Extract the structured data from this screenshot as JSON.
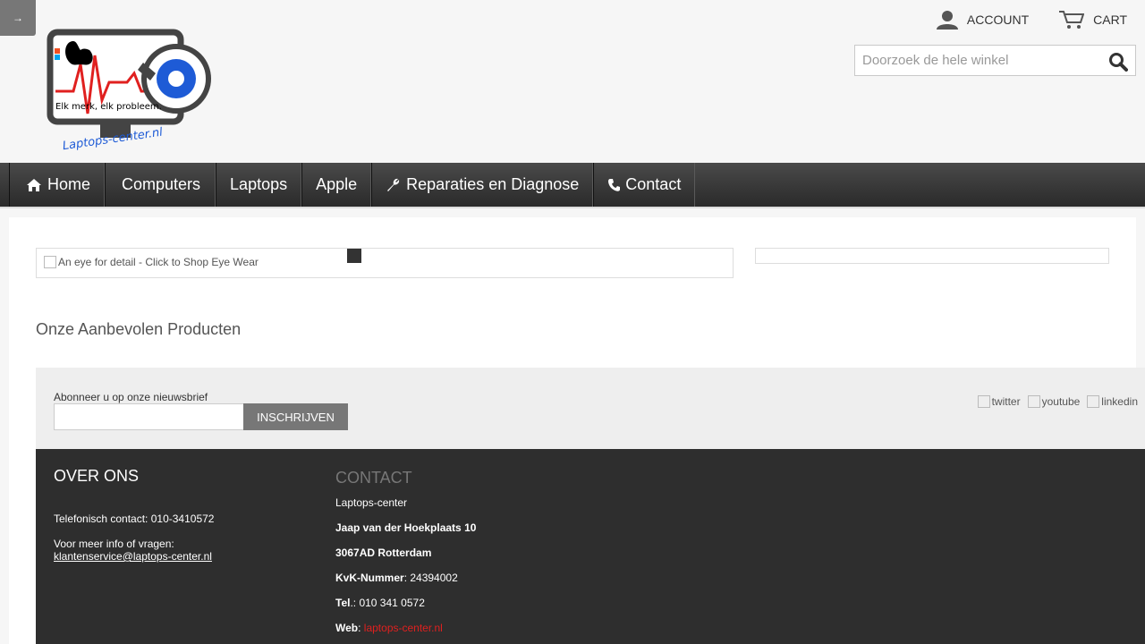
{
  "side_toggle": {
    "label": "→"
  },
  "logo": {
    "tagline": "Elk merk, elk probleem.",
    "brand": "Laptops-center.nl"
  },
  "header": {
    "account_label": "ACCOUNT",
    "cart_label": "CART"
  },
  "search": {
    "placeholder": "Doorzoek de hele winkel"
  },
  "nav": {
    "home": "Home",
    "computers": "Computers",
    "laptops": "Laptops",
    "apple": "Apple",
    "repairs": "Reparaties en Diagnose",
    "contact": "Contact"
  },
  "banner": {
    "alt_text": "An eye for detail - Click to Shop Eye Wear"
  },
  "featured_title": "Onze Aanbevolen Producten",
  "newsletter": {
    "label": "Abonneer u op onze nieuwsbrief",
    "value": "",
    "button": "INSCHRIJVEN"
  },
  "social": {
    "twitter": "twitter",
    "youtube": "youtube",
    "linkedin": "linkedin"
  },
  "footer": {
    "about_title": "OVER ONS",
    "phone_text": "Telefonisch contact: 010-3410572",
    "info_text": "Voor meer info of vragen:",
    "email": "klantenservice@laptops-center.nl",
    "contact_title": "CONTACT",
    "company": "Laptops-center",
    "street": "Jaap van der Hoekplaats 10",
    "city": "3067AD Rotterdam",
    "kvk_label": "KvK-Nummer",
    "kvk_value": ": 24394002",
    "tel_label": "Tel",
    "tel_value": ".: 010 341 0572",
    "web_label": "Web",
    "web_sep": ": ",
    "web_value": "laptops-center.nl"
  },
  "colors": {
    "accent_red": "#e0201f",
    "nav_dark": "#2a2a2a",
    "footer_bg": "#2e2e2e",
    "logo_blue": "#1e5bd6"
  }
}
